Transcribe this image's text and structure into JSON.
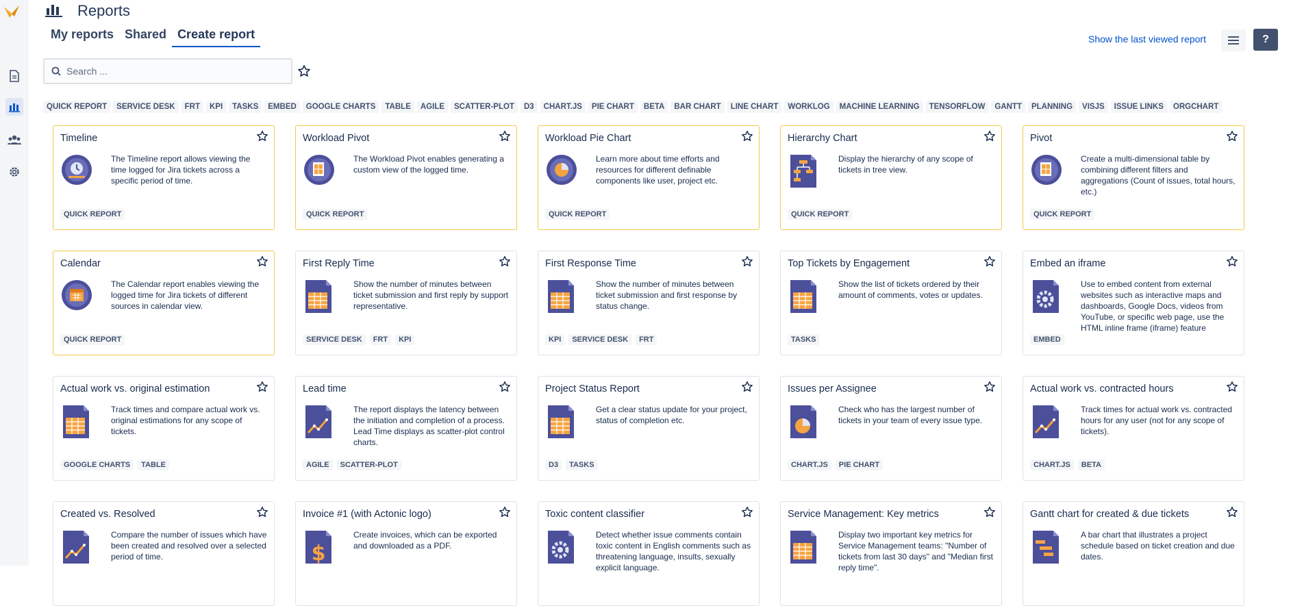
{
  "header": {
    "title": "Reports",
    "last_viewed": "Show the last viewed report",
    "help": "?"
  },
  "tabs": [
    {
      "label": "My reports"
    },
    {
      "label": "Shared"
    },
    {
      "label": "Create report"
    }
  ],
  "search": {
    "placeholder": "Search ..."
  },
  "filters": [
    "QUICK REPORT",
    "SERVICE DESK",
    "FRT",
    "KPI",
    "TASKS",
    "EMBED",
    "GOOGLE CHARTS",
    "TABLE",
    "AGILE",
    "SCATTER-PLOT",
    "D3",
    "CHART.JS",
    "PIE CHART",
    "BETA",
    "BAR CHART",
    "LINE CHART",
    "WORKLOG",
    "MACHINE LEARNING",
    "TENSORFLOW",
    "GANTT",
    "PLANNING",
    "VISJS",
    "ISSUE LINKS",
    "ORGCHART"
  ],
  "colors": {
    "accent": "#0052cc",
    "featured_border": "#f2c94c",
    "icon_purple": "#4c4f9a",
    "icon_orange": "#f5a442"
  },
  "cards": [
    {
      "title": "Timeline",
      "icon": "timeline-icon",
      "description": "The Timeline report allows viewing the time logged for Jira tickets across a specific period of time.",
      "tags": [
        "QUICK REPORT"
      ],
      "featured": true
    },
    {
      "title": "Workload Pivot",
      "icon": "pivot-icon",
      "description": "The Workload Pivot enables generating a custom view of the logged time.",
      "tags": [
        "QUICK REPORT"
      ],
      "featured": true
    },
    {
      "title": "Workload Pie Chart",
      "icon": "pie-chart-icon",
      "description": "Learn more about time efforts and resources for different definable components like user, project etc.",
      "tags": [
        "QUICK REPORT"
      ],
      "featured": true
    },
    {
      "title": "Hierarchy Chart",
      "icon": "hierarchy-icon",
      "description": "Display the hierarchy of any scope of tickets in tree view.",
      "tags": [
        "QUICK REPORT"
      ],
      "featured": true
    },
    {
      "title": "Pivot",
      "icon": "pivot-icon",
      "description": "Create a multi-dimensional table by combining different filters and aggregations (Count of issues, total hours, etc.)",
      "tags": [
        "QUICK REPORT"
      ],
      "featured": true
    },
    {
      "title": "Calendar",
      "icon": "calendar-icon",
      "description": "The Calendar report enables viewing the logged time for Jira tickets of different sources in calendar view.",
      "tags": [
        "QUICK REPORT"
      ],
      "featured": true
    },
    {
      "title": "First Reply Time",
      "icon": "table-doc-icon",
      "description": "Show the number of minutes between ticket submission and first reply by support representative.",
      "tags": [
        "SERVICE DESK",
        "FRT",
        "KPI"
      ],
      "featured": false
    },
    {
      "title": "First Response Time",
      "icon": "table-doc-icon",
      "description": "Show the number of minutes between ticket submission and first response by status change.",
      "tags": [
        "KPI",
        "SERVICE DESK",
        "FRT"
      ],
      "featured": false
    },
    {
      "title": "Top Tickets by Engagement",
      "icon": "table-doc-icon",
      "description": "Show the list of tickets ordered by their amount of comments, votes or updates.",
      "tags": [
        "TASKS"
      ],
      "featured": false
    },
    {
      "title": "Embed an iframe",
      "icon": "gear-doc-icon",
      "description": "Use to embed content from external websites such as interactive maps and dashboards, Google Docs, videos from YouTube, or specific web page, use the HTML inline frame (iframe) feature",
      "tags": [
        "EMBED"
      ],
      "featured": false
    },
    {
      "title": "Actual work vs. original estimation",
      "icon": "table-doc-icon",
      "description": "Track times and compare actual work vs. original estimations for any scope of tickets.",
      "tags": [
        "GOOGLE CHARTS",
        "TABLE"
      ],
      "featured": false
    },
    {
      "title": "Lead time",
      "icon": "line-doc-icon",
      "description": "The report displays the latency between the initiation and completion of a process. Lead Time displays as scatter-plot control charts.",
      "tags": [
        "AGILE",
        "SCATTER-PLOT"
      ],
      "featured": false
    },
    {
      "title": "Project Status Report",
      "icon": "table-doc-icon",
      "description": "Get a clear status update for your project, status of completion etc.",
      "tags": [
        "D3",
        "TASKS"
      ],
      "featured": false
    },
    {
      "title": "Issues per Assignee",
      "icon": "pie-doc-icon",
      "description": "Check who has the largest number of tickets in your team of every issue type.",
      "tags": [
        "CHART.JS",
        "PIE CHART"
      ],
      "featured": false
    },
    {
      "title": "Actual work vs. contracted hours",
      "icon": "line-doc-icon",
      "description": "Track times for actual work vs. contracted hours for any user (not for any scope of tickets).",
      "tags": [
        "CHART.JS",
        "BETA"
      ],
      "featured": false
    },
    {
      "title": "Created vs. Resolved",
      "icon": "line-doc-icon",
      "description": "Compare the number of issues which have been created and resolved over a selected period of time.",
      "tags": [],
      "featured": false
    },
    {
      "title": "Invoice #1 (with Actonic logo)",
      "icon": "dollar-doc-icon",
      "description": "Create invoices, which can be exported and downloaded as a PDF.",
      "tags": [],
      "featured": false
    },
    {
      "title": "Toxic content classifier",
      "icon": "gear-doc-icon",
      "description": "Detect whether issue comments contain toxic content in English comments such as threatening language, insults, sexually explicit language.",
      "tags": [],
      "featured": false
    },
    {
      "title": "Service Management: Key metrics",
      "icon": "table-doc-icon",
      "description": "Display two important key metrics for Service Management teams: \"Number of tickets from last 30 days\" and \"Median first reply time\".",
      "tags": [],
      "featured": false
    },
    {
      "title": "Gantt chart for created & due tickets",
      "icon": "gantt-doc-icon",
      "description": "A bar chart that illustrates a project schedule based on ticket creation and due dates.",
      "tags": [],
      "featured": false
    }
  ]
}
